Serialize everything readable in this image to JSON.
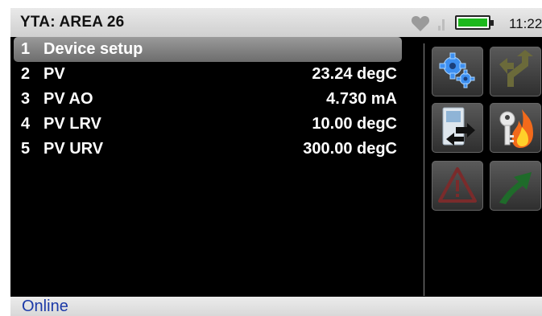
{
  "title_bar": {
    "title": "YTA: AREA 26",
    "clock": "11:22",
    "battery_color": "#1db81d"
  },
  "menu": {
    "items": [
      {
        "num": "1",
        "label": "Device setup",
        "value": "",
        "selected": true
      },
      {
        "num": "2",
        "label": "PV",
        "value": "23.24 degC"
      },
      {
        "num": "3",
        "label": "PV AO",
        "value": "4.730 mA"
      },
      {
        "num": "4",
        "label": "PV LRV",
        "value": "10.00 degC"
      },
      {
        "num": "5",
        "label": "PV URV",
        "value": "300.00 degC"
      }
    ]
  },
  "toolbar": {
    "buttons": [
      {
        "icon": "gear-icon",
        "enabled": true
      },
      {
        "icon": "route-arrow-icon",
        "enabled": false
      },
      {
        "icon": "device-transfer-icon",
        "enabled": true
      },
      {
        "icon": "key-flame-icon",
        "enabled": true
      },
      {
        "icon": "warning-icon",
        "enabled": false
      },
      {
        "icon": "arrow-up-right-icon",
        "enabled": false
      }
    ]
  },
  "status": {
    "text": "Online",
    "color": "#1c3aa8"
  }
}
